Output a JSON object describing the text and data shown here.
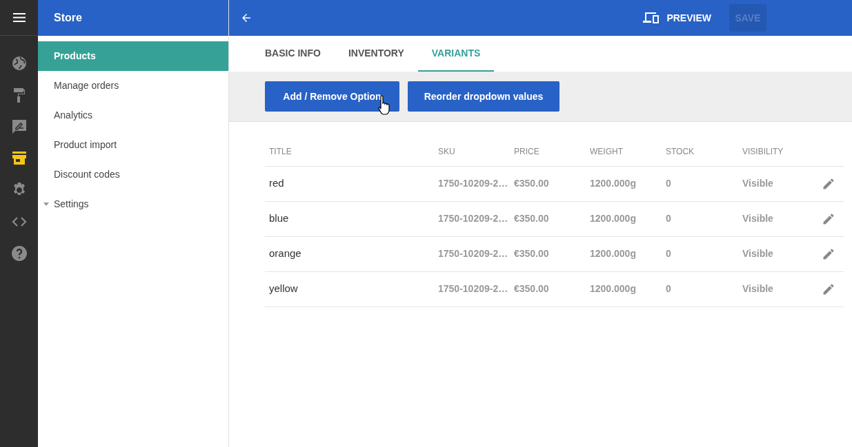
{
  "rail": {
    "items": [
      {
        "kind": "globe",
        "selected": false
      },
      {
        "kind": "roller",
        "selected": false
      },
      {
        "kind": "feedback",
        "selected": false
      },
      {
        "kind": "store",
        "selected": true
      },
      {
        "kind": "gear",
        "selected": false
      },
      {
        "kind": "code",
        "selected": false
      },
      {
        "kind": "help",
        "selected": false
      }
    ]
  },
  "sidebar": {
    "title": "Store",
    "items": [
      {
        "label": "Products",
        "selected": true,
        "kind": "link"
      },
      {
        "label": "Manage orders",
        "selected": false,
        "kind": "link"
      },
      {
        "label": "Analytics",
        "selected": false,
        "kind": "link"
      },
      {
        "label": "Product import",
        "selected": false,
        "kind": "link"
      },
      {
        "label": "Discount codes",
        "selected": false,
        "kind": "link"
      },
      {
        "label": "Settings",
        "selected": false,
        "kind": "group"
      }
    ]
  },
  "toolbar": {
    "preview": "PREVIEW",
    "save": {
      "label": "SAVE",
      "disabled": true
    }
  },
  "tabs": [
    {
      "label": "BASIC INFO",
      "selected": false
    },
    {
      "label": "INVENTORY",
      "selected": false
    },
    {
      "label": "VARIANTS",
      "selected": true
    }
  ],
  "actions": [
    "Add / Remove Option",
    "Reorder dropdown values"
  ],
  "table": {
    "columns": [
      "TITLE",
      "SKU",
      "PRICE",
      "WEIGHT",
      "STOCK",
      "VISIBILITY"
    ],
    "rows": [
      [
        "red",
        "1750-10209-2…",
        "€350.00",
        "1200.000g",
        "0",
        "Visible"
      ],
      [
        "blue",
        "1750-10209-2…",
        "€350.00",
        "1200.000g",
        "0",
        "Visible"
      ],
      [
        "orange",
        "1750-10209-2…",
        "€350.00",
        "1200.000g",
        "0",
        "Visible"
      ],
      [
        "yellow",
        "1750-10209-2…",
        "€350.00",
        "1200.000g",
        "0",
        "Visible"
      ]
    ]
  }
}
